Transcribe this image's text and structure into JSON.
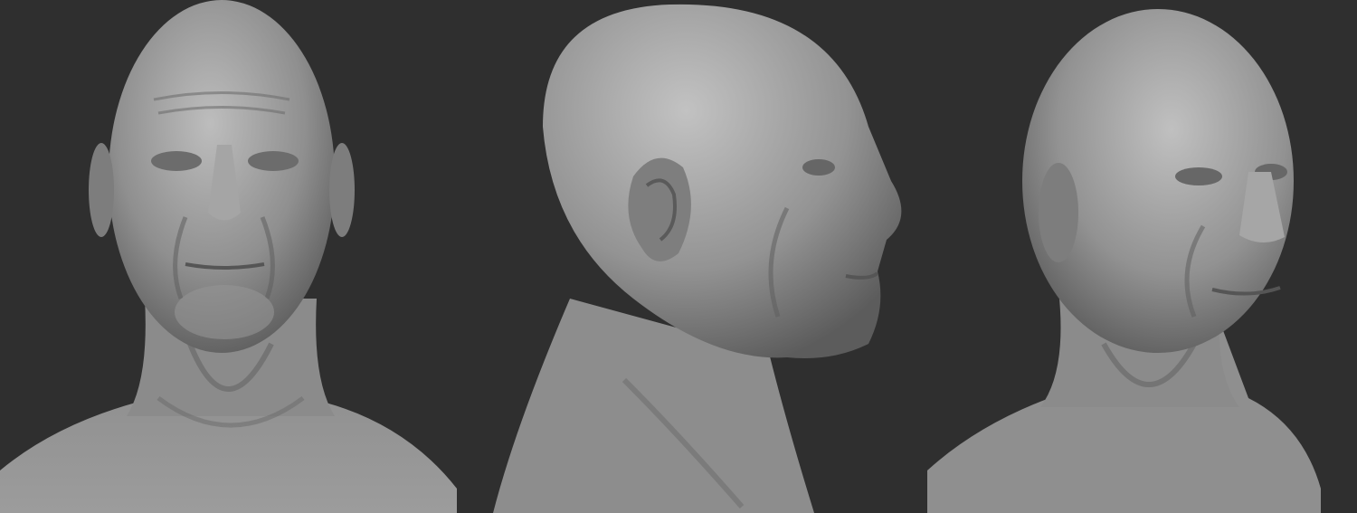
{
  "scene": {
    "background_color": "#2f2f2f",
    "clay_color": "#8e8e8e",
    "highlight_color": "#c8c8c8",
    "shadow_color": "#4a4a4a",
    "views": [
      {
        "id": "front",
        "description_name": "front-view-bust"
      },
      {
        "id": "side",
        "description_name": "side-view-bust"
      },
      {
        "id": "three-quarter",
        "description_name": "three-quarter-view-bust"
      }
    ]
  }
}
